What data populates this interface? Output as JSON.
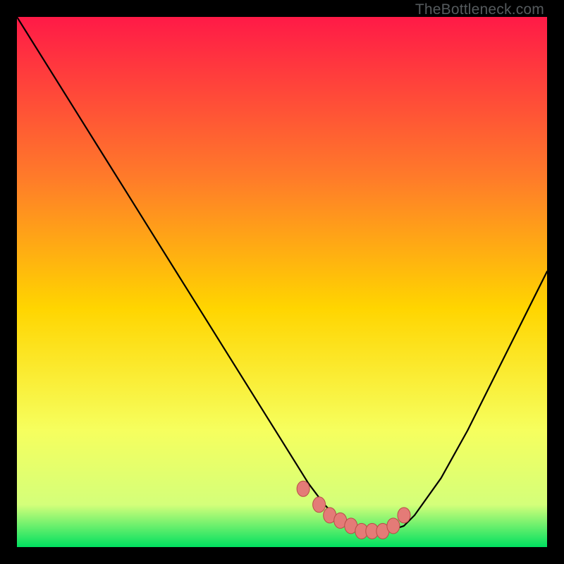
{
  "watermark": "TheBottleneck.com",
  "colors": {
    "gradient_top": "#ff1a47",
    "gradient_mid_upper": "#ff6a2a",
    "gradient_mid": "#ffd500",
    "gradient_mid_lower": "#f6ff5e",
    "gradient_bottom": "#00e060",
    "curve_stroke": "#000000",
    "marker_fill": "#e47b77",
    "marker_stroke": "#b84d47",
    "bg": "#000000"
  },
  "chart_data": {
    "type": "line",
    "title": "",
    "xlabel": "",
    "ylabel": "",
    "xlim": [
      0,
      100
    ],
    "ylim": [
      0,
      100
    ],
    "grid": false,
    "legend": false,
    "series": [
      {
        "name": "bottleneck-curve",
        "x": [
          0,
          5,
          10,
          15,
          20,
          25,
          30,
          35,
          40,
          45,
          50,
          55,
          58,
          60,
          62,
          65,
          68,
          70,
          73,
          75,
          80,
          85,
          90,
          95,
          100
        ],
        "values": [
          100,
          92,
          84,
          76,
          68,
          60,
          52,
          44,
          36,
          28,
          20,
          12,
          8,
          6,
          4,
          3,
          3,
          3,
          4,
          6,
          13,
          22,
          32,
          42,
          52
        ]
      }
    ],
    "markers": {
      "name": "highlighted-region",
      "x": [
        54,
        57,
        59,
        61,
        63,
        65,
        67,
        69,
        71,
        73
      ],
      "values": [
        11,
        8,
        6,
        5,
        4,
        3,
        3,
        3,
        4,
        6
      ]
    }
  }
}
